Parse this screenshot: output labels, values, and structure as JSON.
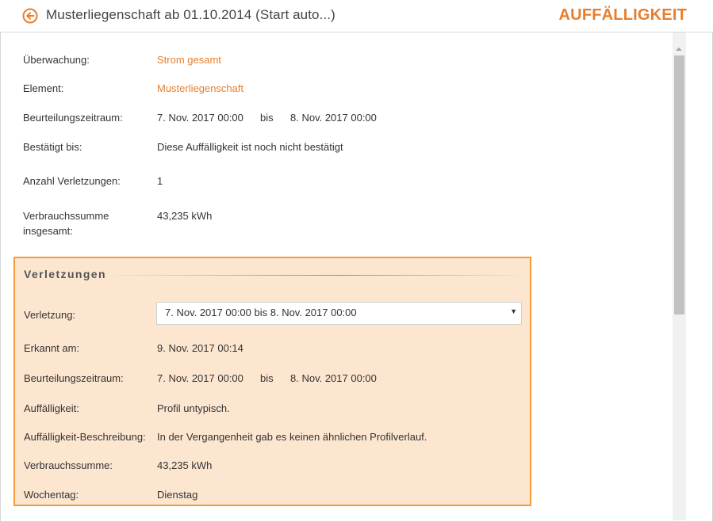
{
  "header": {
    "title": "Musterliegenschaft ab 01.10.2014 (Start auto...)",
    "badge": "AUFFÄLLIGKEIT",
    "accent_color": "#e87e2c",
    "back_icon": "arrow-left-circle-icon"
  },
  "details": {
    "ueberwachung_label": "Überwachung:",
    "ueberwachung_value": "Strom gesamt",
    "element_label": "Element:",
    "element_value": "Musterliegenschaft",
    "zeitraum_label": "Beurteilungszeitraum:",
    "zeitraum_from": "7. Nov. 2017 00:00",
    "zeitraum_bis": "bis",
    "zeitraum_to": "8. Nov. 2017 00:00",
    "bestaetigt_label": "Bestätigt bis:",
    "bestaetigt_value": "Diese Auffälligkeit ist noch nicht bestätigt",
    "anzahl_label": "Anzahl Verletzungen:",
    "anzahl_value": "1",
    "summe_label_line1": "Verbrauchssumme",
    "summe_label_line2": "insgesamt:",
    "summe_value": "43,235 kWh"
  },
  "verletzungen": {
    "title": "Verletzungen",
    "verletzung_label": "Verletzung:",
    "verletzung_selected": "7. Nov. 2017 00:00 bis 8. Nov. 2017 00:00",
    "erkannt_label": "Erkannt am:",
    "erkannt_value": "9. Nov. 2017 00:14",
    "zeitraum_label": "Beurteilungszeitraum:",
    "zeitraum_from": "7. Nov. 2017 00:00",
    "zeitraum_bis": "bis",
    "zeitraum_to": "8. Nov. 2017 00:00",
    "auffaelligkeit_label": "Auffälligkeit:",
    "auffaelligkeit_value": "Profil untypisch.",
    "beschreibung_label": "Auffälligkeit-Beschreibung:",
    "beschreibung_value": "In der Vergangenheit gab es keinen ähnlichen Profilverlauf.",
    "summe_label": "Verbrauchssumme:",
    "summe_value": "43,235 kWh",
    "wochentag_label": "Wochentag:",
    "wochentag_value": "Dienstag",
    "panel_bg_color": "#fde6d0",
    "panel_border_color": "#f39a3a"
  }
}
